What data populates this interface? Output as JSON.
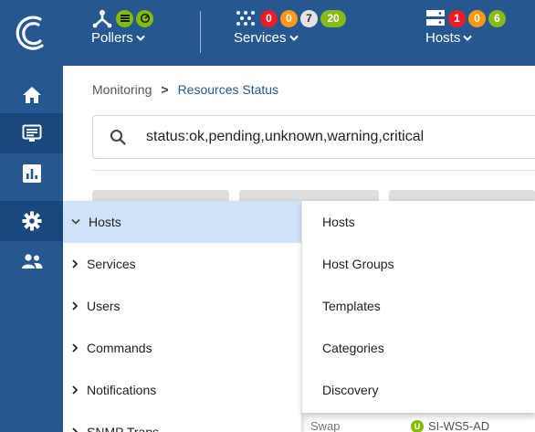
{
  "header": {
    "pollers": {
      "label": "Pollers"
    },
    "services": {
      "label": "Services",
      "counts": {
        "critical": "0",
        "warning": "0",
        "unknown": "7",
        "ok": "20"
      }
    },
    "hosts": {
      "label": "Hosts",
      "counts": {
        "down": "1",
        "unreachable": "0",
        "up": "6"
      }
    }
  },
  "breadcrumb": {
    "parent": "Monitoring",
    "separator": ">",
    "current": "Resources Status"
  },
  "search": {
    "value": "status:ok,pending,unknown,warning,critical"
  },
  "menu_level1": {
    "items": [
      {
        "label": "Hosts",
        "expanded": true
      },
      {
        "label": "Services"
      },
      {
        "label": "Users"
      },
      {
        "label": "Commands"
      },
      {
        "label": "Notifications"
      },
      {
        "label": "SNMP Traps"
      }
    ]
  },
  "menu_level2": {
    "items": [
      {
        "label": "Hosts"
      },
      {
        "label": "Host Groups"
      },
      {
        "label": "Templates"
      },
      {
        "label": "Categories"
      },
      {
        "label": "Discovery"
      }
    ]
  },
  "background_row": {
    "col1": "Swap",
    "status": "U",
    "host": "SI-WS5-AD"
  },
  "colors": {
    "nav_blue": "#255891",
    "nav_active": "#19487d",
    "menu_highlight": "#cfe3f7",
    "critical": "#ed1c24",
    "warning": "#ff9913",
    "unknown": "#e3e3e3",
    "ok": "#88b917"
  }
}
